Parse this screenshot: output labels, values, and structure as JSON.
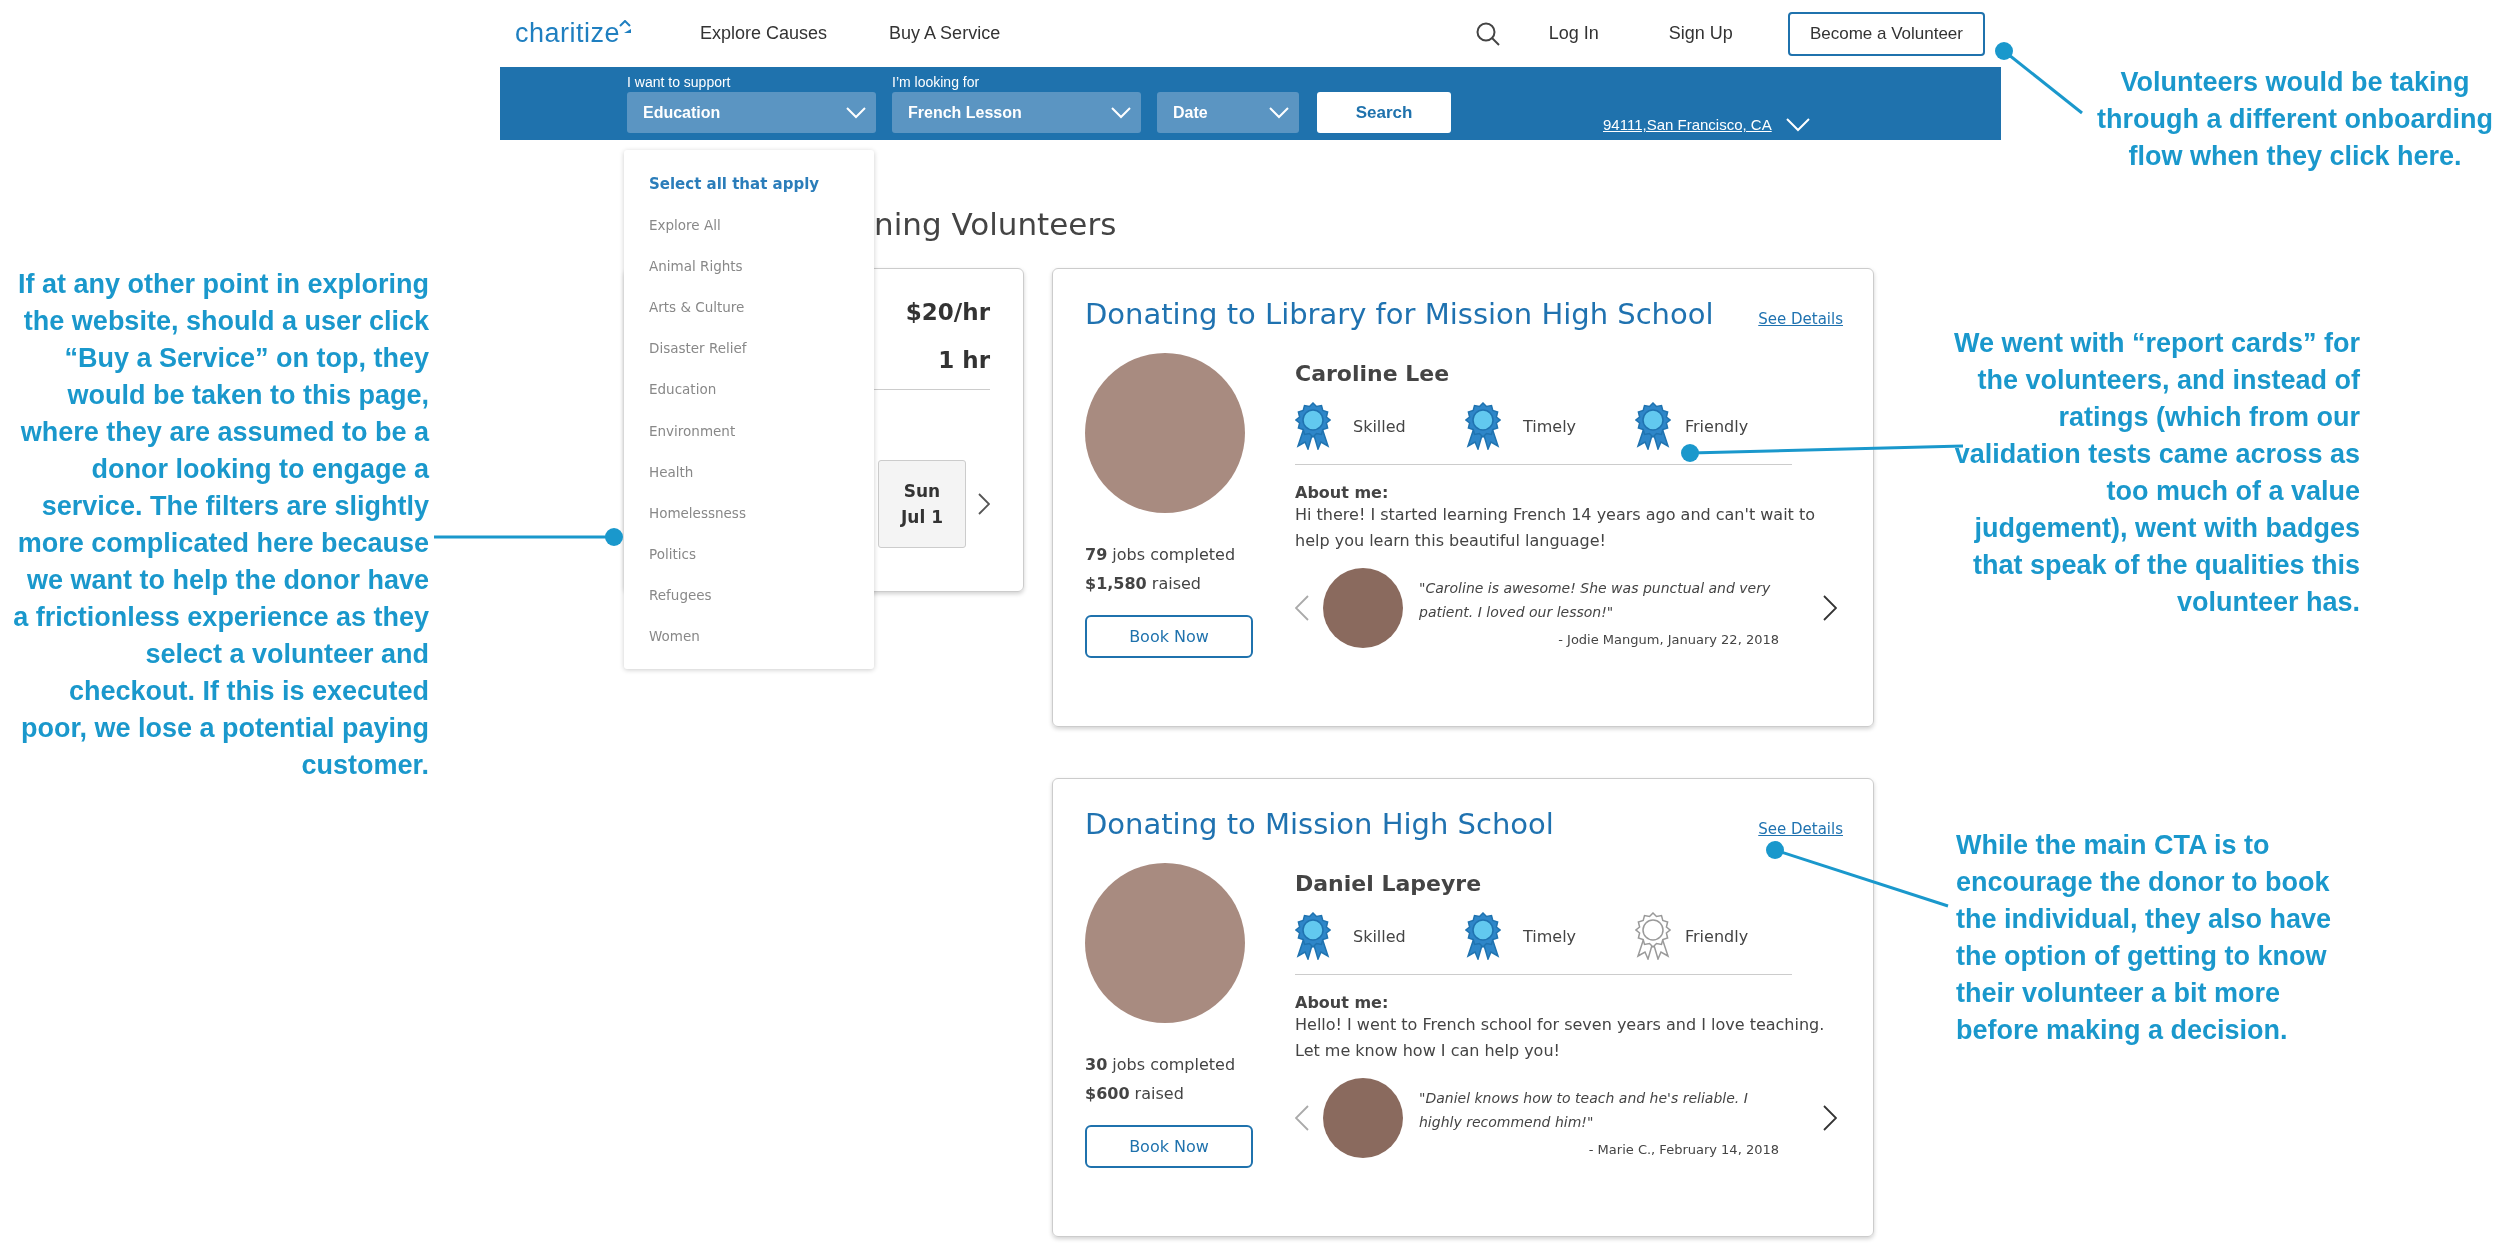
{
  "nav": {
    "logo": "charitize",
    "links": [
      "Explore Causes",
      "Buy A Service"
    ],
    "account_links": [
      "Log In",
      "Sign Up"
    ],
    "cta": "Become a Volunteer"
  },
  "search_bar": {
    "filters": [
      {
        "label": "I want to support",
        "value": "Education"
      },
      {
        "label": "I’m looking for",
        "value": "French Lesson"
      },
      {
        "placeholder": "Date"
      }
    ],
    "search_button": "Search",
    "location": "94111,San Francisco, CA"
  },
  "category_menu": {
    "header": "Select all that apply",
    "items": [
      "Explore All",
      "Animal Rights",
      "Arts & Culture",
      "Disaster Relief",
      "Education",
      "Environment",
      "Health",
      "Homelessness",
      "Politics",
      "Refugees",
      "Women"
    ]
  },
  "heading": "ning Volunteers",
  "summary_card": {
    "rate": "$20/hr",
    "duration": "1 hr",
    "date_day": "Sun",
    "date": "Jul 1"
  },
  "volunteer_cards": [
    {
      "title": "Donating to Library for Mission High School",
      "link": "See Details",
      "name": "Caroline Lee",
      "badges": [
        {
          "label": "Skilled",
          "earned": true
        },
        {
          "label": "Timely",
          "earned": true
        },
        {
          "label": "Friendly",
          "earned": true
        }
      ],
      "about_heading": "About me:",
      "about": "Hi there! I started learning French 14 years ago and can't wait to help you learn this beautiful language!",
      "jobs": "**79** jobs completed",
      "raised": "**$1,580** raised",
      "book_button": "Book Now",
      "review": {
        "quote": "\"Caroline is awesome! She was punctual and very patient. I loved our lesson!\"",
        "author": "- Jodie Mangum, January 22, 2018"
      }
    },
    {
      "title": "Donating to Mission High School",
      "link": "See Details",
      "name": "Daniel Lapeyre",
      "badges": [
        {
          "label": "Skilled",
          "earned": true
        },
        {
          "label": "Timely",
          "earned": true
        },
        {
          "label": "Friendly",
          "earned": false
        }
      ],
      "about_heading": "About me:",
      "about": "Hello! I went to French school for seven years and I love teaching. Let me know how I can help you!",
      "jobs": "**30** jobs completed",
      "raised": "**$600** raised",
      "book_button": "Book Now",
      "review": {
        "quote": "\"Daniel knows how to teach and he's reliable. I highly recommend him!\"",
        "author": "- Marie C., February 14, 2018"
      }
    }
  ],
  "annotations": [
    {
      "text": "Volunteers would be taking through a different onboarding flow when they click here."
    },
    {
      "text": "If at any other point in exploring the website, should a user click “Buy a Service” on top, they would be taken to this page, where they are assumed to be a donor looking to engage a service. The filters are slightly more complicated here because we want to help the donor have a frictionless experience as they select a volunteer and checkout. If this is executed poor, we lose a potential paying customer."
    },
    {
      "text": "We went with “report cards” for the volunteers, and instead of ratings (which from our validation tests came across as too much of a value judgement), went with badges that speak of the qualities this volunteer has."
    },
    {
      "text": "While the main CTA is to encourage the donor to book the individual, they also have the option of getting to know their volunteer a bit more before making a decision."
    }
  ]
}
